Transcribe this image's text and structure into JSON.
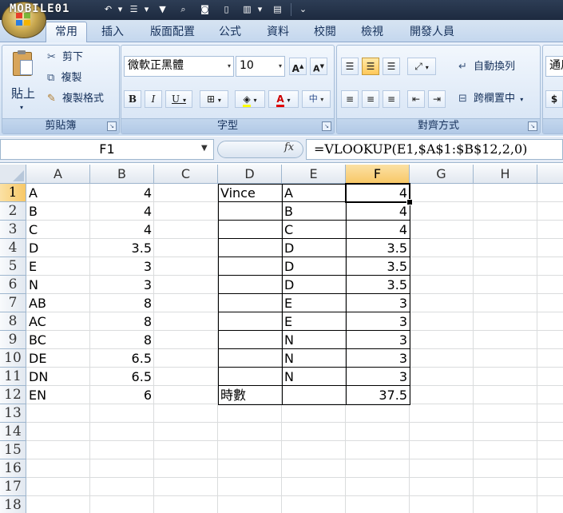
{
  "watermark": "MOBILE01",
  "tabs": [
    {
      "label": "常用",
      "active": true
    },
    {
      "label": "插入"
    },
    {
      "label": "版面配置"
    },
    {
      "label": "公式"
    },
    {
      "label": "資料"
    },
    {
      "label": "校閱"
    },
    {
      "label": "檢視"
    },
    {
      "label": "開發人員"
    }
  ],
  "ribbon": {
    "clipboard": {
      "label": "剪貼簿",
      "paste": "貼上",
      "cut": "剪下",
      "copy": "複製",
      "format_painter": "複製格式"
    },
    "font": {
      "label": "字型",
      "font_name": "微軟正黑體",
      "font_size": "10"
    },
    "alignment": {
      "label": "對齊方式",
      "wrap_text": "自動換列",
      "merge_center": "跨欄置中"
    },
    "number": {
      "format": "通用",
      "currency_symbol": "$"
    }
  },
  "formula_bar": {
    "name_box": "F1",
    "fx_label": "fx",
    "formula": "=VLOOKUP(E1,$A$1:$B$12,2,0)"
  },
  "sheet": {
    "columns": [
      "A",
      "B",
      "C",
      "D",
      "E",
      "F",
      "G",
      "H"
    ],
    "selected_column": "F",
    "rows": [
      "1",
      "2",
      "3",
      "4",
      "5",
      "6",
      "7",
      "8",
      "9",
      "10",
      "11",
      "12",
      "13",
      "14",
      "15",
      "16",
      "17",
      "18"
    ],
    "selected_row": "1",
    "col_a": [
      "A",
      "B",
      "C",
      "D",
      "E",
      "N",
      "AB",
      "AC",
      "BC",
      "DE",
      "DN",
      "EN"
    ],
    "col_b": [
      "4",
      "4",
      "4",
      "3.5",
      "3",
      "3",
      "8",
      "8",
      "8",
      "6.5",
      "6.5",
      "6"
    ],
    "col_d": [
      "Vince",
      "",
      "",
      "",
      "",
      "",
      "",
      "",
      "",
      "",
      "",
      "時數"
    ],
    "col_e": [
      "A",
      "B",
      "C",
      "D",
      "D",
      "D",
      "E",
      "E",
      "N",
      "N",
      "N",
      ""
    ],
    "col_f": [
      "4",
      "4",
      "4",
      "3.5",
      "3.5",
      "3.5",
      "3",
      "3",
      "3",
      "3",
      "3",
      "37.5"
    ]
  }
}
